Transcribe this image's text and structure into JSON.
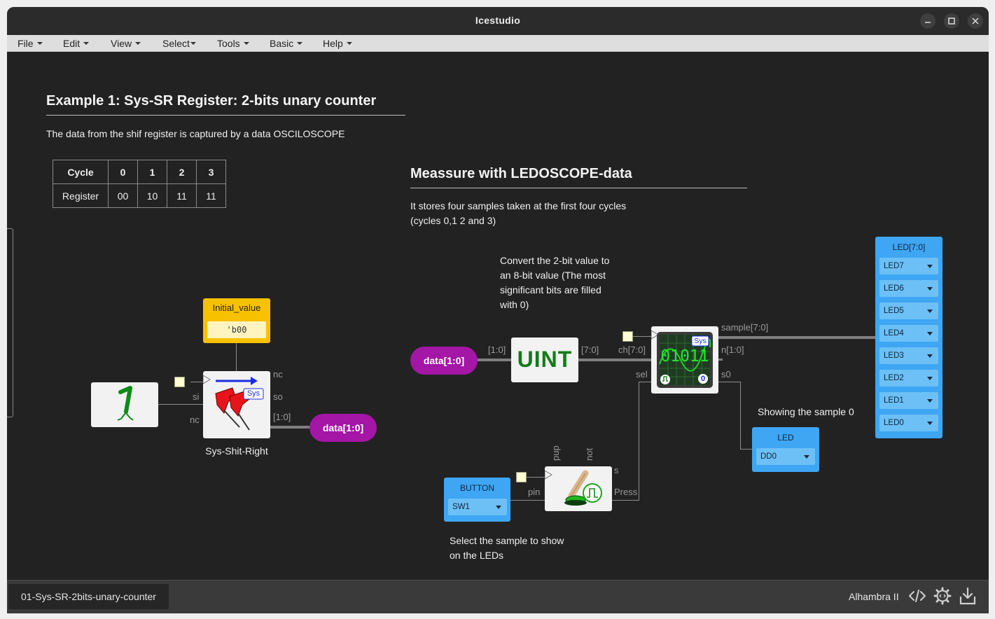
{
  "window": {
    "title": "Icestudio"
  },
  "menu": [
    {
      "label": "File"
    },
    {
      "label": "Edit"
    },
    {
      "label": "View"
    },
    {
      "label": "Select"
    },
    {
      "label": "Tools"
    },
    {
      "label": "Basic"
    },
    {
      "label": "Help"
    }
  ],
  "canvas": {
    "example_title": "Example 1: Sys-SR Register: 2-bits unary counter",
    "example_desc": "The data from the shif register is captured by a data OSCILOSCOPE",
    "table": {
      "headers": [
        "Cycle",
        "0",
        "1",
        "2",
        "3"
      ],
      "row_label": "Register",
      "row_values": [
        "00",
        "10",
        "11",
        "11"
      ]
    },
    "measure_title": "Meassure with LEDOSCOPE-data",
    "measure_desc_1": "It stores four samples taken at the first four cycles",
    "measure_desc_2": "(cycles 0,1 2 and 3)",
    "convert_note": [
      "Convert the 2-bit value to",
      "an 8-bit value (The most",
      "significant bits are filled",
      "with 0)"
    ],
    "showing_note": "Showing the sample 0",
    "select_note": [
      "Select the sample to show",
      "on the LEDs"
    ],
    "initial_value": {
      "label": "Initial_value",
      "value": "'b00"
    },
    "shift_block": {
      "name": "Sys-Shit-Right",
      "badge": "Sys",
      "ports": {
        "nc_top": "nc",
        "si": "si",
        "so": "so",
        "nc_bottom": "nc",
        "bus_out": "[1:0]"
      }
    },
    "data_left": "data[1:0]",
    "data_right": "data[1:0]",
    "uint": {
      "label": "UINT",
      "in": "[1:0]",
      "out": "[7:0]"
    },
    "scope": {
      "badge": "Sys",
      "display": "01011",
      "index_badge": "0",
      "ports": {
        "ch": "ch[7:0]",
        "sel": "sel",
        "sample": "sample[7:0]",
        "n": "n[1:0]",
        "s0": "s0"
      }
    },
    "button_block": {
      "ports": {
        "pup": "pup",
        "not": "not",
        "pin": "pin",
        "s": "s",
        "press": "Press"
      }
    },
    "button_io": {
      "label": "BUTTON",
      "pin": "SW1"
    },
    "led_io": {
      "label": "LED",
      "pin": "DD0"
    },
    "led_bus": {
      "label": "LED[7:0]",
      "pins": [
        "LED7",
        "LED6",
        "LED5",
        "LED4",
        "LED3",
        "LED2",
        "LED1",
        "LED0"
      ]
    }
  },
  "status": {
    "file": "01-Sys-SR-2bits-unary-counter",
    "board": "Alhambra II"
  },
  "colors": {
    "canvas_bg": "#222222",
    "pill": "#a316a6",
    "io_blue": "#3ea6f3",
    "param_yellow": "#f7c100"
  }
}
